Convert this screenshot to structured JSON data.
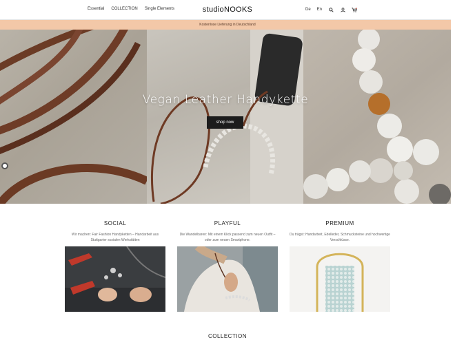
{
  "header": {
    "nav_left": [
      "Essential",
      "COLLECTION",
      "Single Elements"
    ],
    "logo": "studioNOOKS",
    "lang": [
      "De",
      "En"
    ],
    "icons": [
      "search-icon",
      "user-icon",
      "cart-icon"
    ]
  },
  "banner": {
    "text": "Kostenlose Lieferung in Deutschland"
  },
  "hero": {
    "title": "Vegan Leather Handykette",
    "button_label": "shop now"
  },
  "features": [
    {
      "title": "SOCIAL",
      "text": "Wir machen: Fair Fashion Handyketten – Handarbeit aus Stuttgarter sozialen Werkstätten"
    },
    {
      "title": "PLAYFUL",
      "text": "Die Wandelbaren: Mit einem Klick passend zum neuen Outfit – oder zum neuen Smartphone."
    },
    {
      "title": "PREMIUM",
      "text": "Du trägst: Handarbeit, Edelleder, Schmucksteine und hochwertige Verschlüsse."
    }
  ],
  "collection": {
    "title": "COLLECTION"
  },
  "colors": {
    "banner": "#f3c8a8",
    "button": "#1c1c1c"
  }
}
